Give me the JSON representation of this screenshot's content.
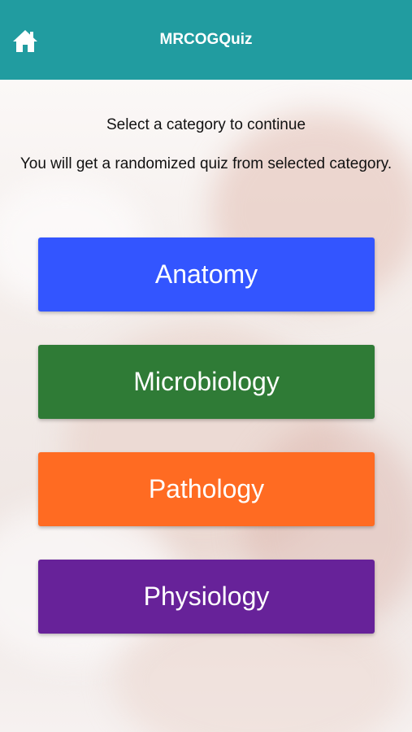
{
  "header": {
    "title": "MRCOGQuiz"
  },
  "intro": {
    "line1": "Select a category to continue",
    "line2": "You will get a randomized quiz from selected category."
  },
  "categories": [
    {
      "label": "Anatomy",
      "color": "#3355ff"
    },
    {
      "label": "Microbiology",
      "color": "#2f7b36"
    },
    {
      "label": "Pathology",
      "color": "#ff6b22"
    },
    {
      "label": "Physiology",
      "color": "#672299"
    }
  ],
  "colors": {
    "header_bg": "#219ca0"
  },
  "icons": {
    "home": "home-icon"
  }
}
